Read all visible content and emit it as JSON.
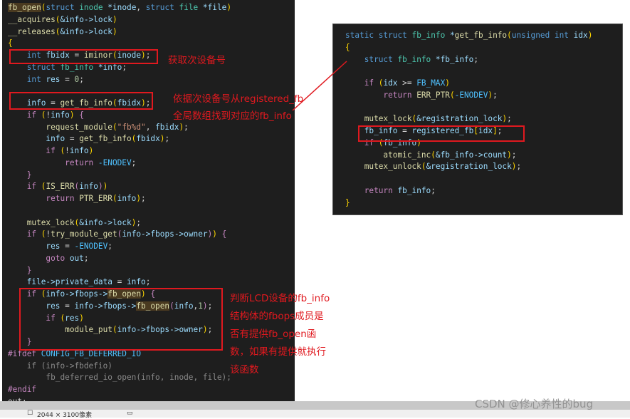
{
  "left_code": [
    [
      [
        "h",
        "fb_open"
      ],
      [
        "y",
        "("
      ],
      [
        "k",
        "struct "
      ],
      [
        "t",
        "inode "
      ],
      [
        "v",
        "*inode"
      ],
      [
        "p",
        ", "
      ],
      [
        "k",
        "struct "
      ],
      [
        "t",
        "file "
      ],
      [
        "v",
        "*file"
      ],
      [
        "y",
        ")"
      ]
    ],
    [
      [
        "f",
        "__acquires"
      ],
      [
        "y",
        "("
      ],
      [
        "v",
        "&info->lock"
      ],
      [
        "y",
        ")"
      ]
    ],
    [
      [
        "f",
        "__releases"
      ],
      [
        "y",
        "("
      ],
      [
        "v",
        "&info->lock"
      ],
      [
        "y",
        ")"
      ]
    ],
    [
      [
        "y",
        "{"
      ]
    ],
    [
      [
        "k",
        "    int "
      ],
      [
        "v",
        "fbidx "
      ],
      [
        "p",
        "= "
      ],
      [
        "f",
        "iminor"
      ],
      [
        "y",
        "("
      ],
      [
        "v",
        "inode"
      ],
      [
        "y",
        ")"
      ],
      [
        "p",
        ";"
      ]
    ],
    [
      [
        "k",
        "    struct "
      ],
      [
        "t",
        "fb_info "
      ],
      [
        "v",
        "*info"
      ],
      [
        "p",
        ";"
      ]
    ],
    [
      [
        "k",
        "    int "
      ],
      [
        "v",
        "res "
      ],
      [
        "p",
        "= "
      ],
      [
        "n",
        "0"
      ],
      [
        "p",
        ";"
      ]
    ],
    [
      [
        "p",
        ""
      ]
    ],
    [
      [
        "v",
        "    info "
      ],
      [
        "p",
        "= "
      ],
      [
        "f",
        "get_fb_info"
      ],
      [
        "y",
        "("
      ],
      [
        "v",
        "fbidx"
      ],
      [
        "y",
        ")"
      ],
      [
        "p",
        ";"
      ]
    ],
    [
      [
        "c",
        "    if "
      ],
      [
        "y",
        "("
      ],
      [
        "p",
        "!"
      ],
      [
        "v",
        "info"
      ],
      [
        "y",
        ") "
      ],
      [
        "c",
        "{"
      ]
    ],
    [
      [
        "f",
        "        request_module"
      ],
      [
        "y",
        "("
      ],
      [
        "s",
        "\"fb%d\""
      ],
      [
        "p",
        ", "
      ],
      [
        "v",
        "fbidx"
      ],
      [
        "y",
        ")"
      ],
      [
        "p",
        ";"
      ]
    ],
    [
      [
        "v",
        "        info "
      ],
      [
        "p",
        "= "
      ],
      [
        "f",
        "get_fb_info"
      ],
      [
        "y",
        "("
      ],
      [
        "v",
        "fbidx"
      ],
      [
        "y",
        ")"
      ],
      [
        "p",
        ";"
      ]
    ],
    [
      [
        "c",
        "        if "
      ],
      [
        "y",
        "("
      ],
      [
        "p",
        "!"
      ],
      [
        "v",
        "info"
      ],
      [
        "y",
        ")"
      ]
    ],
    [
      [
        "c",
        "            return "
      ],
      [
        "m",
        "-ENODEV"
      ],
      [
        "p",
        ";"
      ]
    ],
    [
      [
        "c",
        "    }"
      ]
    ],
    [
      [
        "c",
        "    if "
      ],
      [
        "y",
        "("
      ],
      [
        "f",
        "IS_ERR"
      ],
      [
        "c",
        "("
      ],
      [
        "v",
        "info"
      ],
      [
        "c",
        ")"
      ],
      [
        "y",
        ")"
      ]
    ],
    [
      [
        "c",
        "        return "
      ],
      [
        "f",
        "PTR_ERR"
      ],
      [
        "y",
        "("
      ],
      [
        "v",
        "info"
      ],
      [
        "y",
        ")"
      ],
      [
        "p",
        ";"
      ]
    ],
    [
      [
        "p",
        ""
      ]
    ],
    [
      [
        "f",
        "    mutex_lock"
      ],
      [
        "y",
        "("
      ],
      [
        "v",
        "&info->lock"
      ],
      [
        "y",
        ")"
      ],
      [
        "p",
        ";"
      ]
    ],
    [
      [
        "c",
        "    if "
      ],
      [
        "y",
        "("
      ],
      [
        "p",
        "!"
      ],
      [
        "f",
        "try_module_get"
      ],
      [
        "c",
        "("
      ],
      [
        "v",
        "info->fbops->owner"
      ],
      [
        "c",
        ")"
      ],
      [
        "y",
        ") "
      ],
      [
        "c",
        "{"
      ]
    ],
    [
      [
        "v",
        "        res "
      ],
      [
        "p",
        "= "
      ],
      [
        "m",
        "-ENODEV"
      ],
      [
        "p",
        ";"
      ]
    ],
    [
      [
        "c",
        "        goto "
      ],
      [
        "v",
        "out"
      ],
      [
        "p",
        ";"
      ]
    ],
    [
      [
        "c",
        "    }"
      ]
    ],
    [
      [
        "v",
        "    file->private_data "
      ],
      [
        "p",
        "= "
      ],
      [
        "v",
        "info"
      ],
      [
        "p",
        ";"
      ]
    ],
    [
      [
        "c",
        "    if "
      ],
      [
        "y",
        "("
      ],
      [
        "v",
        "info->fbops->"
      ],
      [
        "h",
        "fb_open"
      ],
      [
        "y",
        ") "
      ],
      [
        "c",
        "{"
      ]
    ],
    [
      [
        "v",
        "        res "
      ],
      [
        "p",
        "= "
      ],
      [
        "v",
        "info->fbops->"
      ],
      [
        "h",
        "fb_open"
      ],
      [
        "c",
        "("
      ],
      [
        "v",
        "info"
      ],
      [
        "p",
        ","
      ],
      [
        "n",
        "1"
      ],
      [
        "c",
        ")"
      ],
      [
        "p",
        ";"
      ]
    ],
    [
      [
        "c",
        "        if "
      ],
      [
        "y",
        "("
      ],
      [
        "v",
        "res"
      ],
      [
        "y",
        ")"
      ]
    ],
    [
      [
        "f",
        "            module_put"
      ],
      [
        "y",
        "("
      ],
      [
        "v",
        "info->fbops->owner"
      ],
      [
        "y",
        ")"
      ],
      [
        "p",
        ";"
      ]
    ],
    [
      [
        "c",
        "    }"
      ]
    ],
    [
      [
        "pp",
        "#ifdef "
      ],
      [
        "m",
        "CONFIG_FB_DEFERRED_IO"
      ]
    ],
    [
      [
        "d",
        "    if (info->fbdefio)"
      ]
    ],
    [
      [
        "d",
        "        fb_deferred_io_open(info, inode, file);"
      ]
    ],
    [
      [
        "pp",
        "#endif"
      ]
    ],
    [
      [
        "p",
        "out:"
      ]
    ]
  ],
  "right_code": [
    [
      [
        "k",
        "static struct "
      ],
      [
        "t",
        "fb_info "
      ],
      [
        "v",
        "*"
      ],
      [
        "f",
        "get_fb_info"
      ],
      [
        "y",
        "("
      ],
      [
        "k",
        "unsigned int "
      ],
      [
        "v",
        "idx"
      ],
      [
        "y",
        ")"
      ]
    ],
    [
      [
        "y",
        "{"
      ]
    ],
    [
      [
        "k",
        "    struct "
      ],
      [
        "t",
        "fb_info "
      ],
      [
        "v",
        "*fb_info"
      ],
      [
        "p",
        ";"
      ]
    ],
    [
      [
        "p",
        ""
      ]
    ],
    [
      [
        "c",
        "    if "
      ],
      [
        "y",
        "("
      ],
      [
        "v",
        "idx "
      ],
      [
        "p",
        ">= "
      ],
      [
        "m",
        "FB_MAX"
      ],
      [
        "y",
        ")"
      ]
    ],
    [
      [
        "c",
        "        return "
      ],
      [
        "f",
        "ERR_PTR"
      ],
      [
        "y",
        "("
      ],
      [
        "m",
        "-ENODEV"
      ],
      [
        "y",
        ")"
      ],
      [
        "p",
        ";"
      ]
    ],
    [
      [
        "p",
        ""
      ]
    ],
    [
      [
        "f",
        "    mutex_lock"
      ],
      [
        "y",
        "("
      ],
      [
        "v",
        "&registration_lock"
      ],
      [
        "y",
        ")"
      ],
      [
        "p",
        ";"
      ]
    ],
    [
      [
        "v",
        "    fb_info "
      ],
      [
        "p",
        "= "
      ],
      [
        "v",
        "registered_fb"
      ],
      [
        "y",
        "["
      ],
      [
        "v",
        "idx"
      ],
      [
        "y",
        "]"
      ],
      [
        "p",
        ";"
      ]
    ],
    [
      [
        "c",
        "    if "
      ],
      [
        "y",
        "("
      ],
      [
        "v",
        "fb_info"
      ],
      [
        "y",
        ")"
      ]
    ],
    [
      [
        "f",
        "        atomic_inc"
      ],
      [
        "y",
        "("
      ],
      [
        "v",
        "&fb_info->count"
      ],
      [
        "y",
        ")"
      ],
      [
        "p",
        ";"
      ]
    ],
    [
      [
        "f",
        "    mutex_unlock"
      ],
      [
        "y",
        "("
      ],
      [
        "v",
        "&registration_lock"
      ],
      [
        "y",
        ")"
      ],
      [
        "p",
        ";"
      ]
    ],
    [
      [
        "p",
        ""
      ]
    ],
    [
      [
        "c",
        "    return "
      ],
      [
        "v",
        "fb_info"
      ],
      [
        "p",
        ";"
      ]
    ],
    [
      [
        "y",
        "}"
      ]
    ]
  ],
  "annotations": {
    "minor_number": "获取次设备号",
    "lookup_line1": "依据次设备号从registered_fb",
    "lookup_line2": "全局数组找到对应的fb_info",
    "fb_open_lines": [
      "判断LCD设备的fb_info",
      "结构体的fbops成员是",
      "否有提供fb_open函",
      "数，如果有提供就执行",
      "该函数"
    ]
  },
  "status_bar": {
    "image_size": "2044 × 3100像素"
  },
  "watermark": "CSDN @修心养性的bug",
  "colors": {
    "annotation": "#e0191f",
    "editor_bg": "#1e1e1e"
  }
}
